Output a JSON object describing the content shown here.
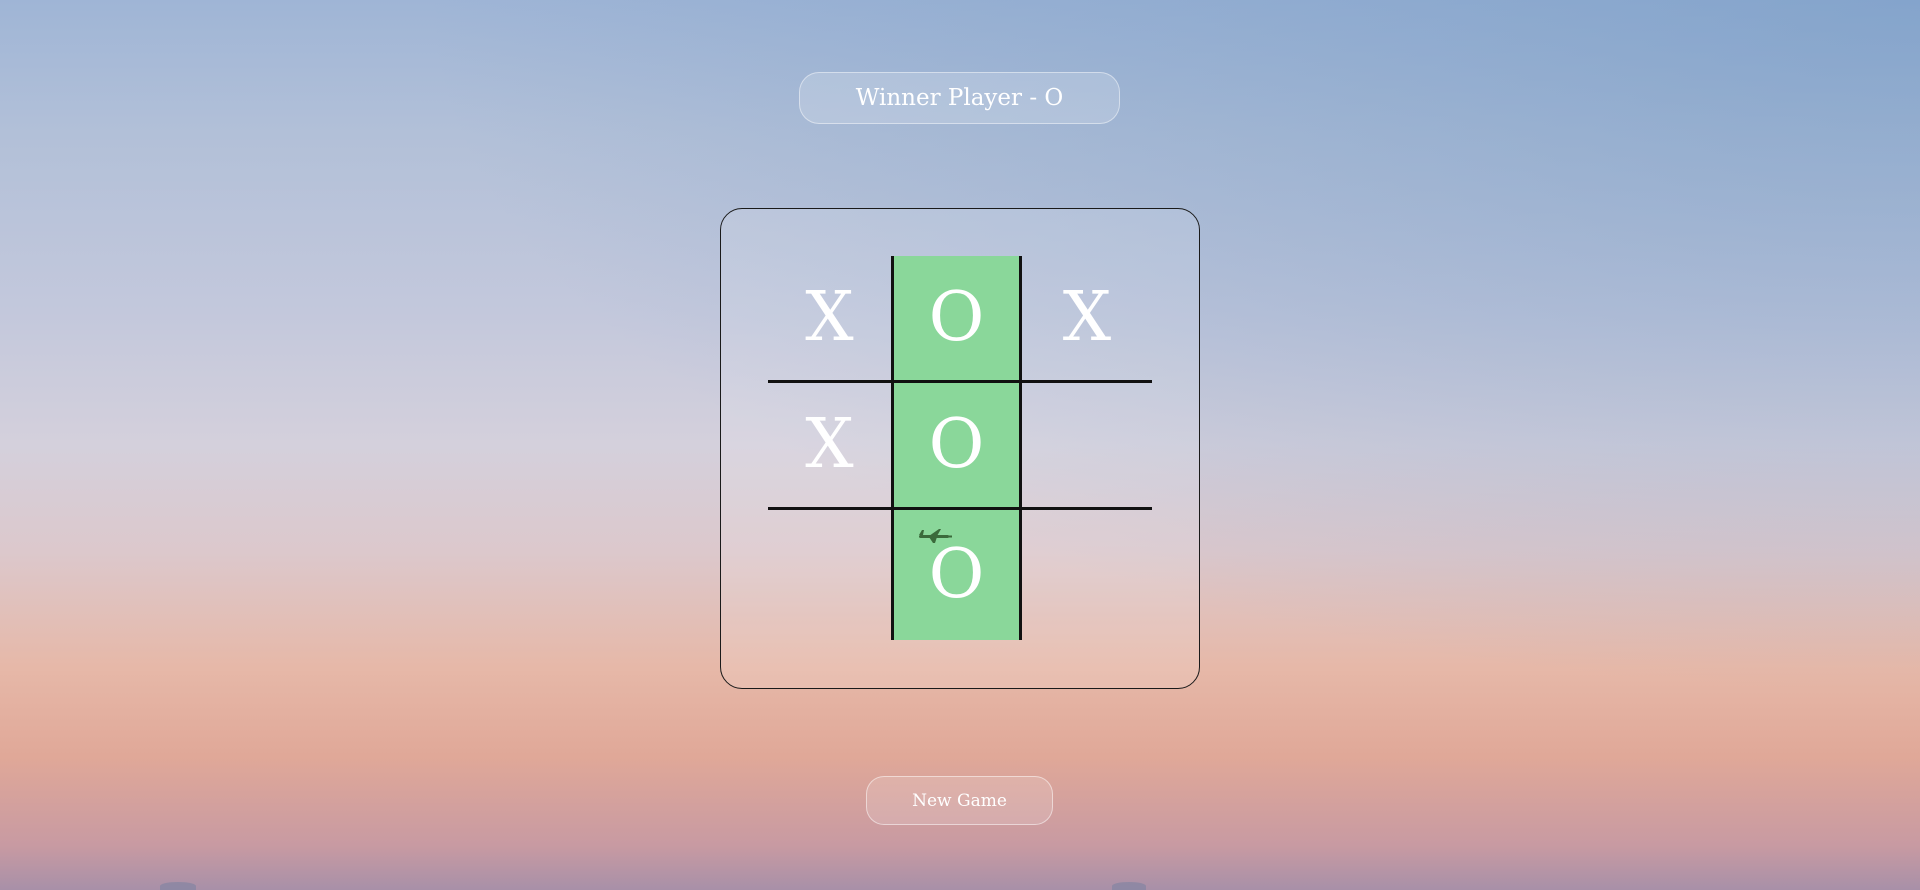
{
  "status": {
    "text": "Winner Player - O"
  },
  "board": {
    "cells": [
      "X",
      "O",
      "X",
      "X",
      "O",
      "",
      "",
      "O",
      ""
    ],
    "winning_cells": [
      1,
      4,
      7
    ],
    "winning_color": "#8ad79a"
  },
  "controls": {
    "new_game_label": "New Game"
  },
  "colors": {
    "grid_line": "#111111",
    "mark": "#ffffff"
  }
}
